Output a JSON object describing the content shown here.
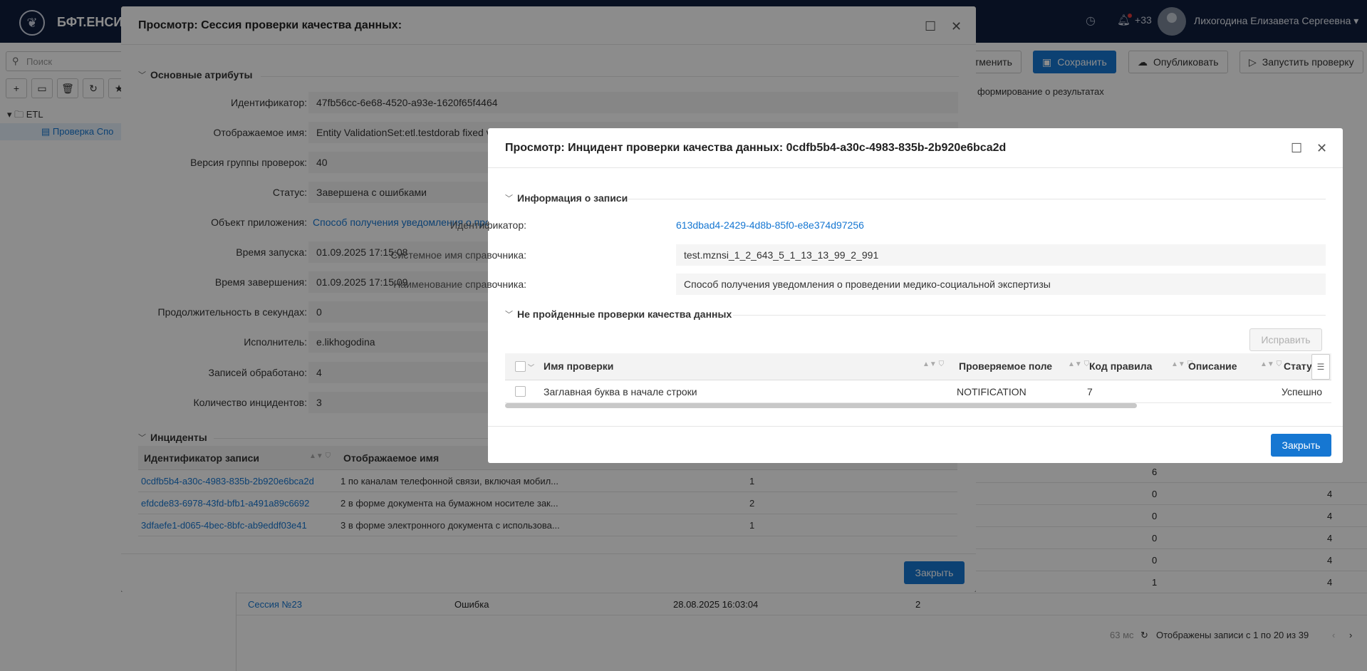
{
  "app": {
    "title": "БФТ.ЕНСИ",
    "notifications": "+33",
    "user_name": "Лихогодина Елизавета Сергеевна"
  },
  "sidebar": {
    "search_placeholder": "Поиск",
    "tree": [
      {
        "label": "ETL"
      },
      {
        "label": "Проверка Спо"
      }
    ]
  },
  "toolbar": {
    "cancel": "Отменить",
    "save": "Сохранить",
    "publish": "Опубликовать",
    "run_check": "Запустить проверку"
  },
  "tabs": {
    "results": "формирование о результатах"
  },
  "background_rows": [
    {
      "a": "6",
      "b": ""
    },
    {
      "a": "0",
      "b": "4"
    },
    {
      "a": "0",
      "b": "4"
    },
    {
      "a": "0",
      "b": "4"
    },
    {
      "a": "0",
      "b": "4"
    },
    {
      "a": "1",
      "b": "4"
    }
  ],
  "background_last_row": {
    "session": "Сессия №23",
    "status": "Ошибка",
    "date": "28.08.2025 16:03:04",
    "count": "2"
  },
  "background_footer": {
    "timing": "63 мс",
    "records": "Отображены записи с 1 по 20 из 39"
  },
  "session_dialog": {
    "title": "Просмотр: Сессия проверки качества данных:",
    "section_main": "Основные атрибуты",
    "fields": [
      {
        "label": "Идентификатор:",
        "value": "47fb56cc-6e68-4520-a93e-1620f65f4464"
      },
      {
        "label": "Отображаемое имя:",
        "value": "Entity ValidationSet:etl.testdorab fixed v"
      },
      {
        "label": "Версия группы проверок:",
        "value": "40"
      },
      {
        "label": "Статус:",
        "value": "Завершена с ошибками"
      },
      {
        "label": "Объект приложения:",
        "value": "Способ получения уведомления о про"
      },
      {
        "label": "Время запуска:",
        "value": "01.09.2025 17:15:08"
      },
      {
        "label": "Время завершения:",
        "value": "01.09.2025 17:15:09"
      },
      {
        "label": "Продолжительность в секундах:",
        "value": "0"
      },
      {
        "label": "Исполнитель:",
        "value": "e.likhogodina"
      },
      {
        "label": "Записей обработано:",
        "value": "4"
      },
      {
        "label": "Количество инцидентов:",
        "value": "3"
      }
    ],
    "section_incidents": "Инциденты",
    "incidents_columns": [
      "Идентификатор записи",
      "Отображаемое имя"
    ],
    "incidents": [
      {
        "id": "0cdfb5b4-a30c-4983-835b-2b920e6bca2d",
        "name": "1 по каналам телефонной связи, включая мобил...",
        "count": "1"
      },
      {
        "id": "efdcde83-6978-43fd-bfb1-a491a89c6692",
        "name": "2 в форме документа на бумажном носителе зак...",
        "count": "2"
      },
      {
        "id": "3dfaefe1-d065-4bec-8bfc-ab9eddf03e41",
        "name": "3 в форме электронного документа с использова...",
        "count": "1"
      }
    ],
    "close": "Закрыть"
  },
  "incident_dialog": {
    "title": "Просмотр: Инцидент проверки качества данных: 0cdfb5b4-a30c-4983-835b-2b920e6bca2d",
    "section_info": "Информация о записи",
    "fields": [
      {
        "label": "Идентификатор:",
        "value": "613dbad4-2429-4d8b-85f0-e8e374d97256"
      },
      {
        "label": "Системное имя справочника:",
        "value": "test.mznsi_1_2_643_5_1_13_13_99_2_991"
      },
      {
        "label": "Наименование справочника:",
        "value": "Способ получения уведомления о проведении медико-социальной экспертизы"
      }
    ],
    "section_failed": "Не пройденные проверки качества данных",
    "fix_button": "Исправить",
    "columns": [
      "Имя проверки",
      "Проверяемое поле",
      "Код правила",
      "Описание",
      "Статус и"
    ],
    "rows": [
      {
        "name": "Заглавная буква в начале строки",
        "field": "NOTIFICATION",
        "code": "7",
        "description": "",
        "status": "Успешно"
      }
    ],
    "close": "Закрыть"
  }
}
